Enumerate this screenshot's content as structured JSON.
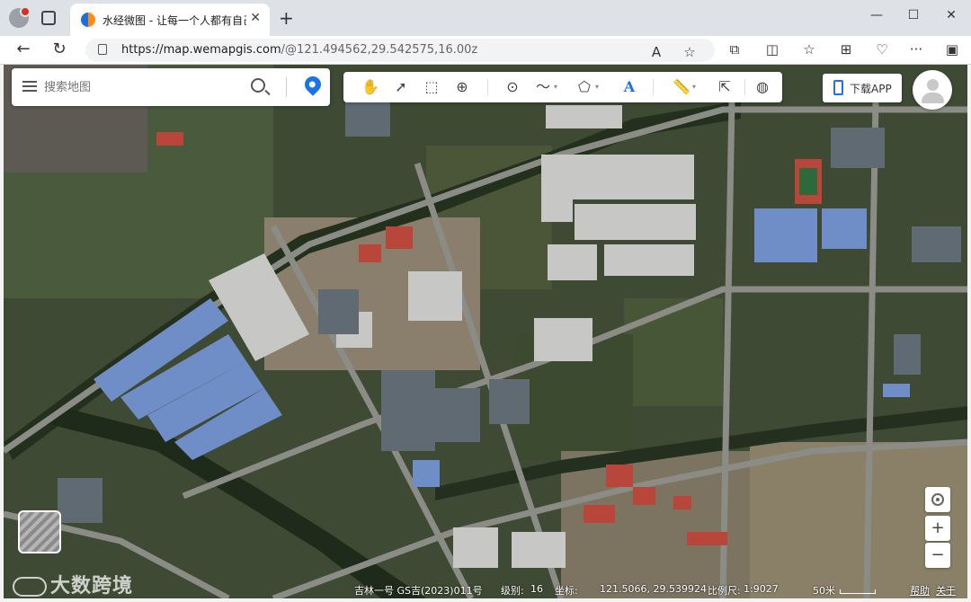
{
  "browser": {
    "tab_title": "水经微图 - 让每一个人都有自己的",
    "url_main": "https://map.wemapgis.com",
    "url_rest": "/@121.494562,29.542575,16.00z",
    "new_tab_symbol": "+",
    "close_symbol": "✕"
  },
  "search": {
    "placeholder": "搜索地图"
  },
  "toolbar": {
    "tools": [
      "hand-icon",
      "pointer-icon",
      "select-box-icon",
      "zoom-area-icon",
      "marker-icon",
      "polyline-icon",
      "polygon-icon",
      "text-icon",
      "ruler-icon",
      "cursor-info-icon",
      "globe-icon"
    ],
    "text_tool_label": "A"
  },
  "header_right": {
    "download_app": "下载APP"
  },
  "zoom": {
    "plus": "+",
    "minus": "−"
  },
  "watermark": "大数跨境",
  "status": {
    "imagery": "吉林一号 GS吉(2023)011号",
    "level_label": "级别:",
    "level": "16",
    "coord_label": "坐标:",
    "coords": "121.5066, 29.539924",
    "scale_label": "比例尺:",
    "scale": "1:9027",
    "scalebar_label": "50米",
    "help": "帮助",
    "about": "关于"
  },
  "colors": {
    "accent": "#1a73e8",
    "field_green": "#3e4c2c",
    "roof_blue": "#5b7fc9",
    "roof_red": "#b8463a",
    "water": "#27331f"
  }
}
